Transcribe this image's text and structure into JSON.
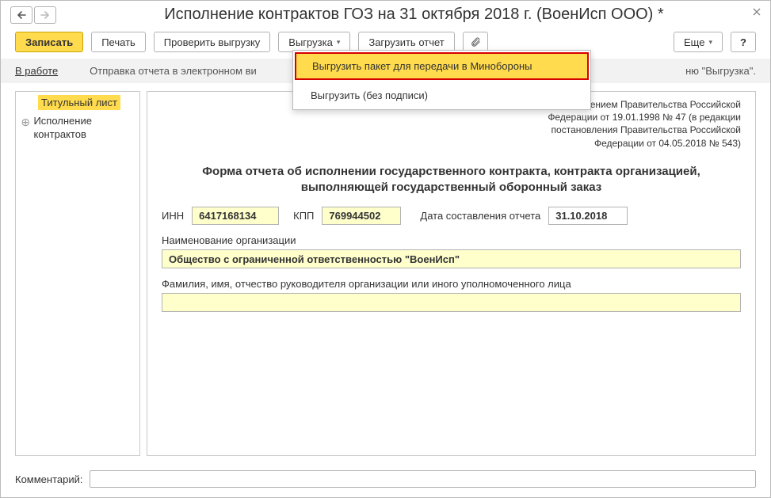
{
  "title": "Исполнение контрактов ГОЗ на 31 октября 2018 г. (ВоенИсп ООО) *",
  "toolbar": {
    "write": "Записать",
    "print": "Печать",
    "check": "Проверить выгрузку",
    "export": "Выгрузка",
    "load": "Загрузить отчет",
    "more": "Еще",
    "help": "?"
  },
  "dropdown": {
    "item1": "Выгрузить пакет для передачи в Минобороны",
    "item2": "Выгрузить (без подписи)"
  },
  "strip": {
    "link": "В работе",
    "text_left": "Отправка отчета в электронном ви",
    "text_right": "ню \"Выгрузка\"."
  },
  "sidebar": {
    "title": "Титульный лист",
    "item2": "Исполнение контрактов"
  },
  "decree": {
    "l2": "постановлением Правительства Российской",
    "l3": "Федерации от 19.01.1998 № 47 (в редакции",
    "l4": "постановления Правительства Российской",
    "l5": "Федерации от 04.05.2018 № 543)"
  },
  "form_title": "Форма отчета об исполнении государственного контракта, контракта организацией, выполняющей государственный оборонный заказ",
  "fields": {
    "inn_lbl": "ИНН",
    "inn_val": "6417168134",
    "kpp_lbl": "КПП",
    "kpp_val": "769944502",
    "date_lbl": "Дата составления отчета",
    "date_val": "31.10.2018",
    "org_lbl": "Наименование организации",
    "org_val": "Общество с ограниченной ответственностью \"ВоенИсп\"",
    "fio_lbl": "Фамилия, имя, отчество руководителя организации или иного уполномоченного лица",
    "fio_val": ""
  },
  "footer": {
    "comment_lbl": "Комментарий:"
  }
}
